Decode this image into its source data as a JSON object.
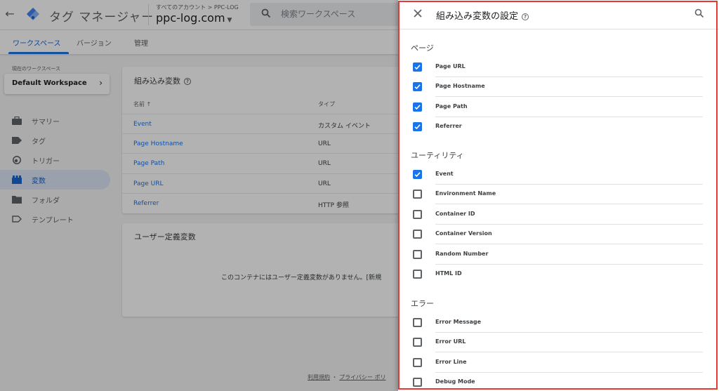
{
  "topbar": {
    "back_icon": "arrow-left-icon",
    "app_name": "タグ マネージャー",
    "account_crumb": "すべてのアカウント > PPC-LOG",
    "container_name": "ppc-log.com",
    "search_placeholder": "検索ワークスペース"
  },
  "tabs": [
    {
      "label": "ワークスペース",
      "active": true
    },
    {
      "label": "バージョン"
    },
    {
      "label": "管理"
    }
  ],
  "sidebar": {
    "workspace_caption": "現在のワークスペース",
    "workspace_name": "Default Workspace",
    "items": [
      {
        "label": "サマリー",
        "icon": "briefcase-icon"
      },
      {
        "label": "タグ",
        "icon": "tag-icon"
      },
      {
        "label": "トリガー",
        "icon": "trigger-icon"
      },
      {
        "label": "変数",
        "icon": "variables-icon",
        "active": true
      },
      {
        "label": "フォルダ",
        "icon": "folder-icon"
      },
      {
        "label": "テンプレート",
        "icon": "template-icon"
      }
    ]
  },
  "builtin_card": {
    "title": "組み込み変数",
    "col_name": "名前 ↑",
    "col_type": "タイプ",
    "rows": [
      {
        "name": "Event",
        "type": "カスタム イベント"
      },
      {
        "name": "Page Hostname",
        "type": "URL"
      },
      {
        "name": "Page Path",
        "type": "URL"
      },
      {
        "name": "Page URL",
        "type": "URL"
      },
      {
        "name": "Referrer",
        "type": "HTTP 参照"
      }
    ]
  },
  "user_card": {
    "title": "ユーザー定義変数",
    "empty_message": "このコンテナにはユーザー定義変数がありません。[新規"
  },
  "footer": {
    "terms": "利用規約",
    "sep": "・",
    "privacy": "プライバシー ポリ"
  },
  "panel": {
    "title": "組み込み変数の設定",
    "sections": [
      {
        "title": "ページ",
        "items": [
          {
            "label": "Page URL",
            "checked": true
          },
          {
            "label": "Page Hostname",
            "checked": true
          },
          {
            "label": "Page Path",
            "checked": true
          },
          {
            "label": "Referrer",
            "checked": true
          }
        ]
      },
      {
        "title": "ユーティリティ",
        "items": [
          {
            "label": "Event",
            "checked": true
          },
          {
            "label": "Environment Name",
            "checked": false
          },
          {
            "label": "Container ID",
            "checked": false
          },
          {
            "label": "Container Version",
            "checked": false
          },
          {
            "label": "Random Number",
            "checked": false
          },
          {
            "label": "HTML ID",
            "checked": false
          }
        ]
      },
      {
        "title": "エラー",
        "items": [
          {
            "label": "Error Message",
            "checked": false
          },
          {
            "label": "Error URL",
            "checked": false
          },
          {
            "label": "Error Line",
            "checked": false
          },
          {
            "label": "Debug Mode",
            "checked": false
          }
        ]
      }
    ]
  },
  "colors": {
    "accent": "#1a73e8",
    "highlight_outline": "#e53935",
    "nav_active_bg": "#dde7f6"
  }
}
